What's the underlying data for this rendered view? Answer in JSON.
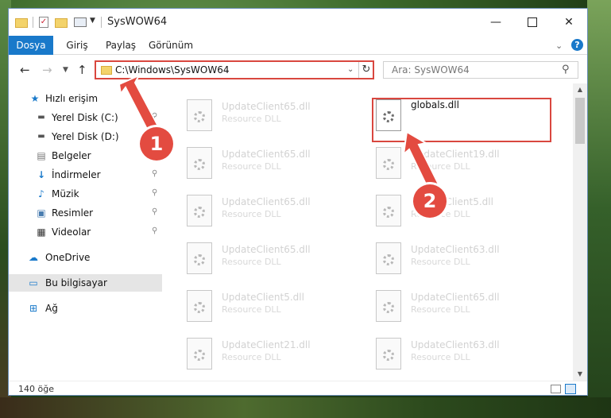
{
  "window": {
    "title": "SysWOW64"
  },
  "ribbon": {
    "tabs": [
      "Dosya",
      "Giriş",
      "Paylaş",
      "Görünüm"
    ]
  },
  "address": {
    "path": "C:\\Windows\\SysWOW64"
  },
  "search": {
    "placeholder": "Ara: SysWOW64"
  },
  "sidebar": {
    "items": [
      {
        "label": "Hızlı erişim",
        "icon": "star-icon"
      },
      {
        "label": "Yerel Disk (C:)",
        "icon": "drive-icon"
      },
      {
        "label": "Yerel Disk (D:)",
        "icon": "drive-icon"
      },
      {
        "label": "Belgeler",
        "icon": "documents-icon"
      },
      {
        "label": "İndirmeler",
        "icon": "download-icon"
      },
      {
        "label": "Müzik",
        "icon": "music-icon"
      },
      {
        "label": "Resimler",
        "icon": "pictures-icon"
      },
      {
        "label": "Videolar",
        "icon": "video-icon"
      },
      {
        "label": "OneDrive",
        "icon": "cloud-icon"
      },
      {
        "label": "Bu bilgisayar",
        "icon": "computer-icon"
      },
      {
        "label": "Ağ",
        "icon": "network-icon"
      }
    ]
  },
  "files": [
    {
      "name": "UpdateClient65.dll",
      "type": "Resource DLL"
    },
    {
      "name": "globals.dll",
      "type": ""
    },
    {
      "name": "UpdateClient65.dll",
      "type": "Resource DLL"
    },
    {
      "name": "UpdateClient19.dll",
      "type": "Resource DLL"
    },
    {
      "name": "UpdateClient65.dll",
      "type": "Resource DLL"
    },
    {
      "name": "UpdateClient5.dll",
      "type": "Resource DLL"
    },
    {
      "name": "UpdateClient65.dll",
      "type": "Resource DLL"
    },
    {
      "name": "UpdateClient63.dll",
      "type": "Resource DLL"
    },
    {
      "name": "UpdateClient5.dll",
      "type": "Resource DLL"
    },
    {
      "name": "UpdateClient65.dll",
      "type": "Resource DLL"
    },
    {
      "name": "UpdateClient21.dll",
      "type": "Resource DLL"
    },
    {
      "name": "UpdateClient63.dll",
      "type": "Resource DLL"
    }
  ],
  "status": {
    "count": "140 öğe"
  },
  "callouts": {
    "one": "1",
    "two": "2"
  },
  "colors": {
    "accent": "#1979ca",
    "highlight": "#d9473f"
  }
}
